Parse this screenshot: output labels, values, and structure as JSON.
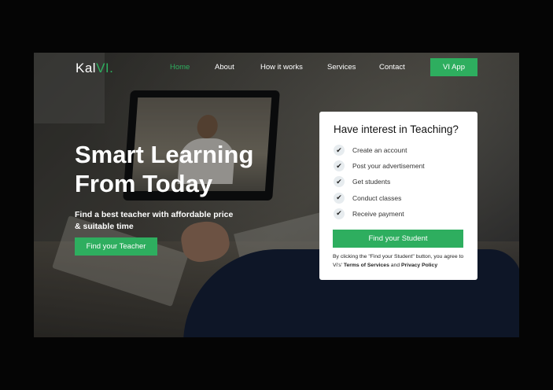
{
  "brand": {
    "name_main": "Kal",
    "name_accent": "VI."
  },
  "nav": {
    "items": [
      {
        "label": "Home",
        "active": true
      },
      {
        "label": "About",
        "active": false
      },
      {
        "label": "How it works",
        "active": false
      },
      {
        "label": "Services",
        "active": false
      },
      {
        "label": "Contact",
        "active": false
      }
    ],
    "app_button": "VI App"
  },
  "hero": {
    "title": "Smart Learning From Today",
    "subtitle": "Find a best teacher with affordable price & suitable time",
    "cta": "Find your Teacher"
  },
  "card": {
    "title": "Have interest in Teaching?",
    "steps": [
      {
        "label": "Create an account",
        "icon": "check-icon"
      },
      {
        "label": "Post your advertisement",
        "icon": "check-icon"
      },
      {
        "label": "Get students",
        "icon": "check-icon"
      },
      {
        "label": "Conduct classes",
        "icon": "check-icon"
      },
      {
        "label": "Receive payment",
        "icon": "check-icon"
      }
    ],
    "cta": "Find your Student",
    "terms": {
      "prefix": "By clicking the \"Find your Student\" button, you agree to Vi's'",
      "terms_link": "Terms of Services",
      "joiner": "and",
      "privacy_link": "Privacy Policy"
    }
  },
  "colors": {
    "accent": "#2eae5f",
    "page_bg": "#050505",
    "card_bg": "#ffffff"
  }
}
